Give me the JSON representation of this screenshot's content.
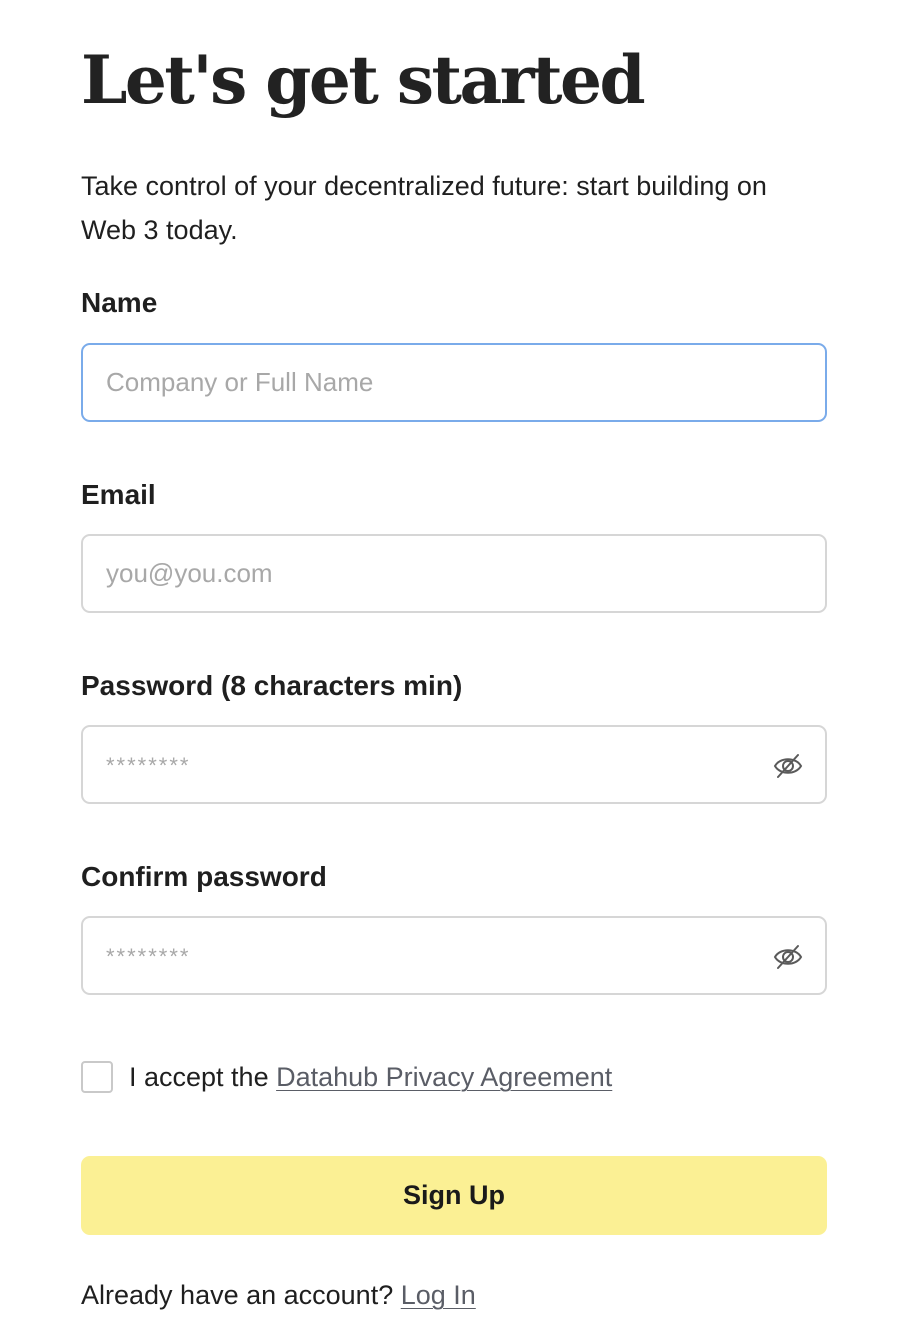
{
  "header": {
    "title": "Let's get started",
    "subtitle": "Take control of your decentralized future: start building on Web 3 today."
  },
  "form": {
    "name": {
      "label": "Name",
      "placeholder": "Company or Full Name",
      "value": ""
    },
    "email": {
      "label": "Email",
      "placeholder": "you@you.com",
      "value": ""
    },
    "password": {
      "label": "Password (8 characters min)",
      "placeholder": "********",
      "value": "",
      "toggle_icon": "eye-off-icon"
    },
    "confirm_password": {
      "label": "Confirm password",
      "placeholder": "********",
      "value": "",
      "toggle_icon": "eye-off-icon"
    },
    "agreement": {
      "checked": false,
      "prefix": "I accept the ",
      "link_text": "Datahub Privacy Agreement"
    },
    "submit_label": "Sign Up"
  },
  "footer": {
    "prompt": "Already have an account? ",
    "login_link": "Log In"
  },
  "colors": {
    "button_bg": "#fbf094",
    "focus_border": "#7aabea",
    "input_border": "#d6d6d6",
    "link": "#5a5d66"
  }
}
